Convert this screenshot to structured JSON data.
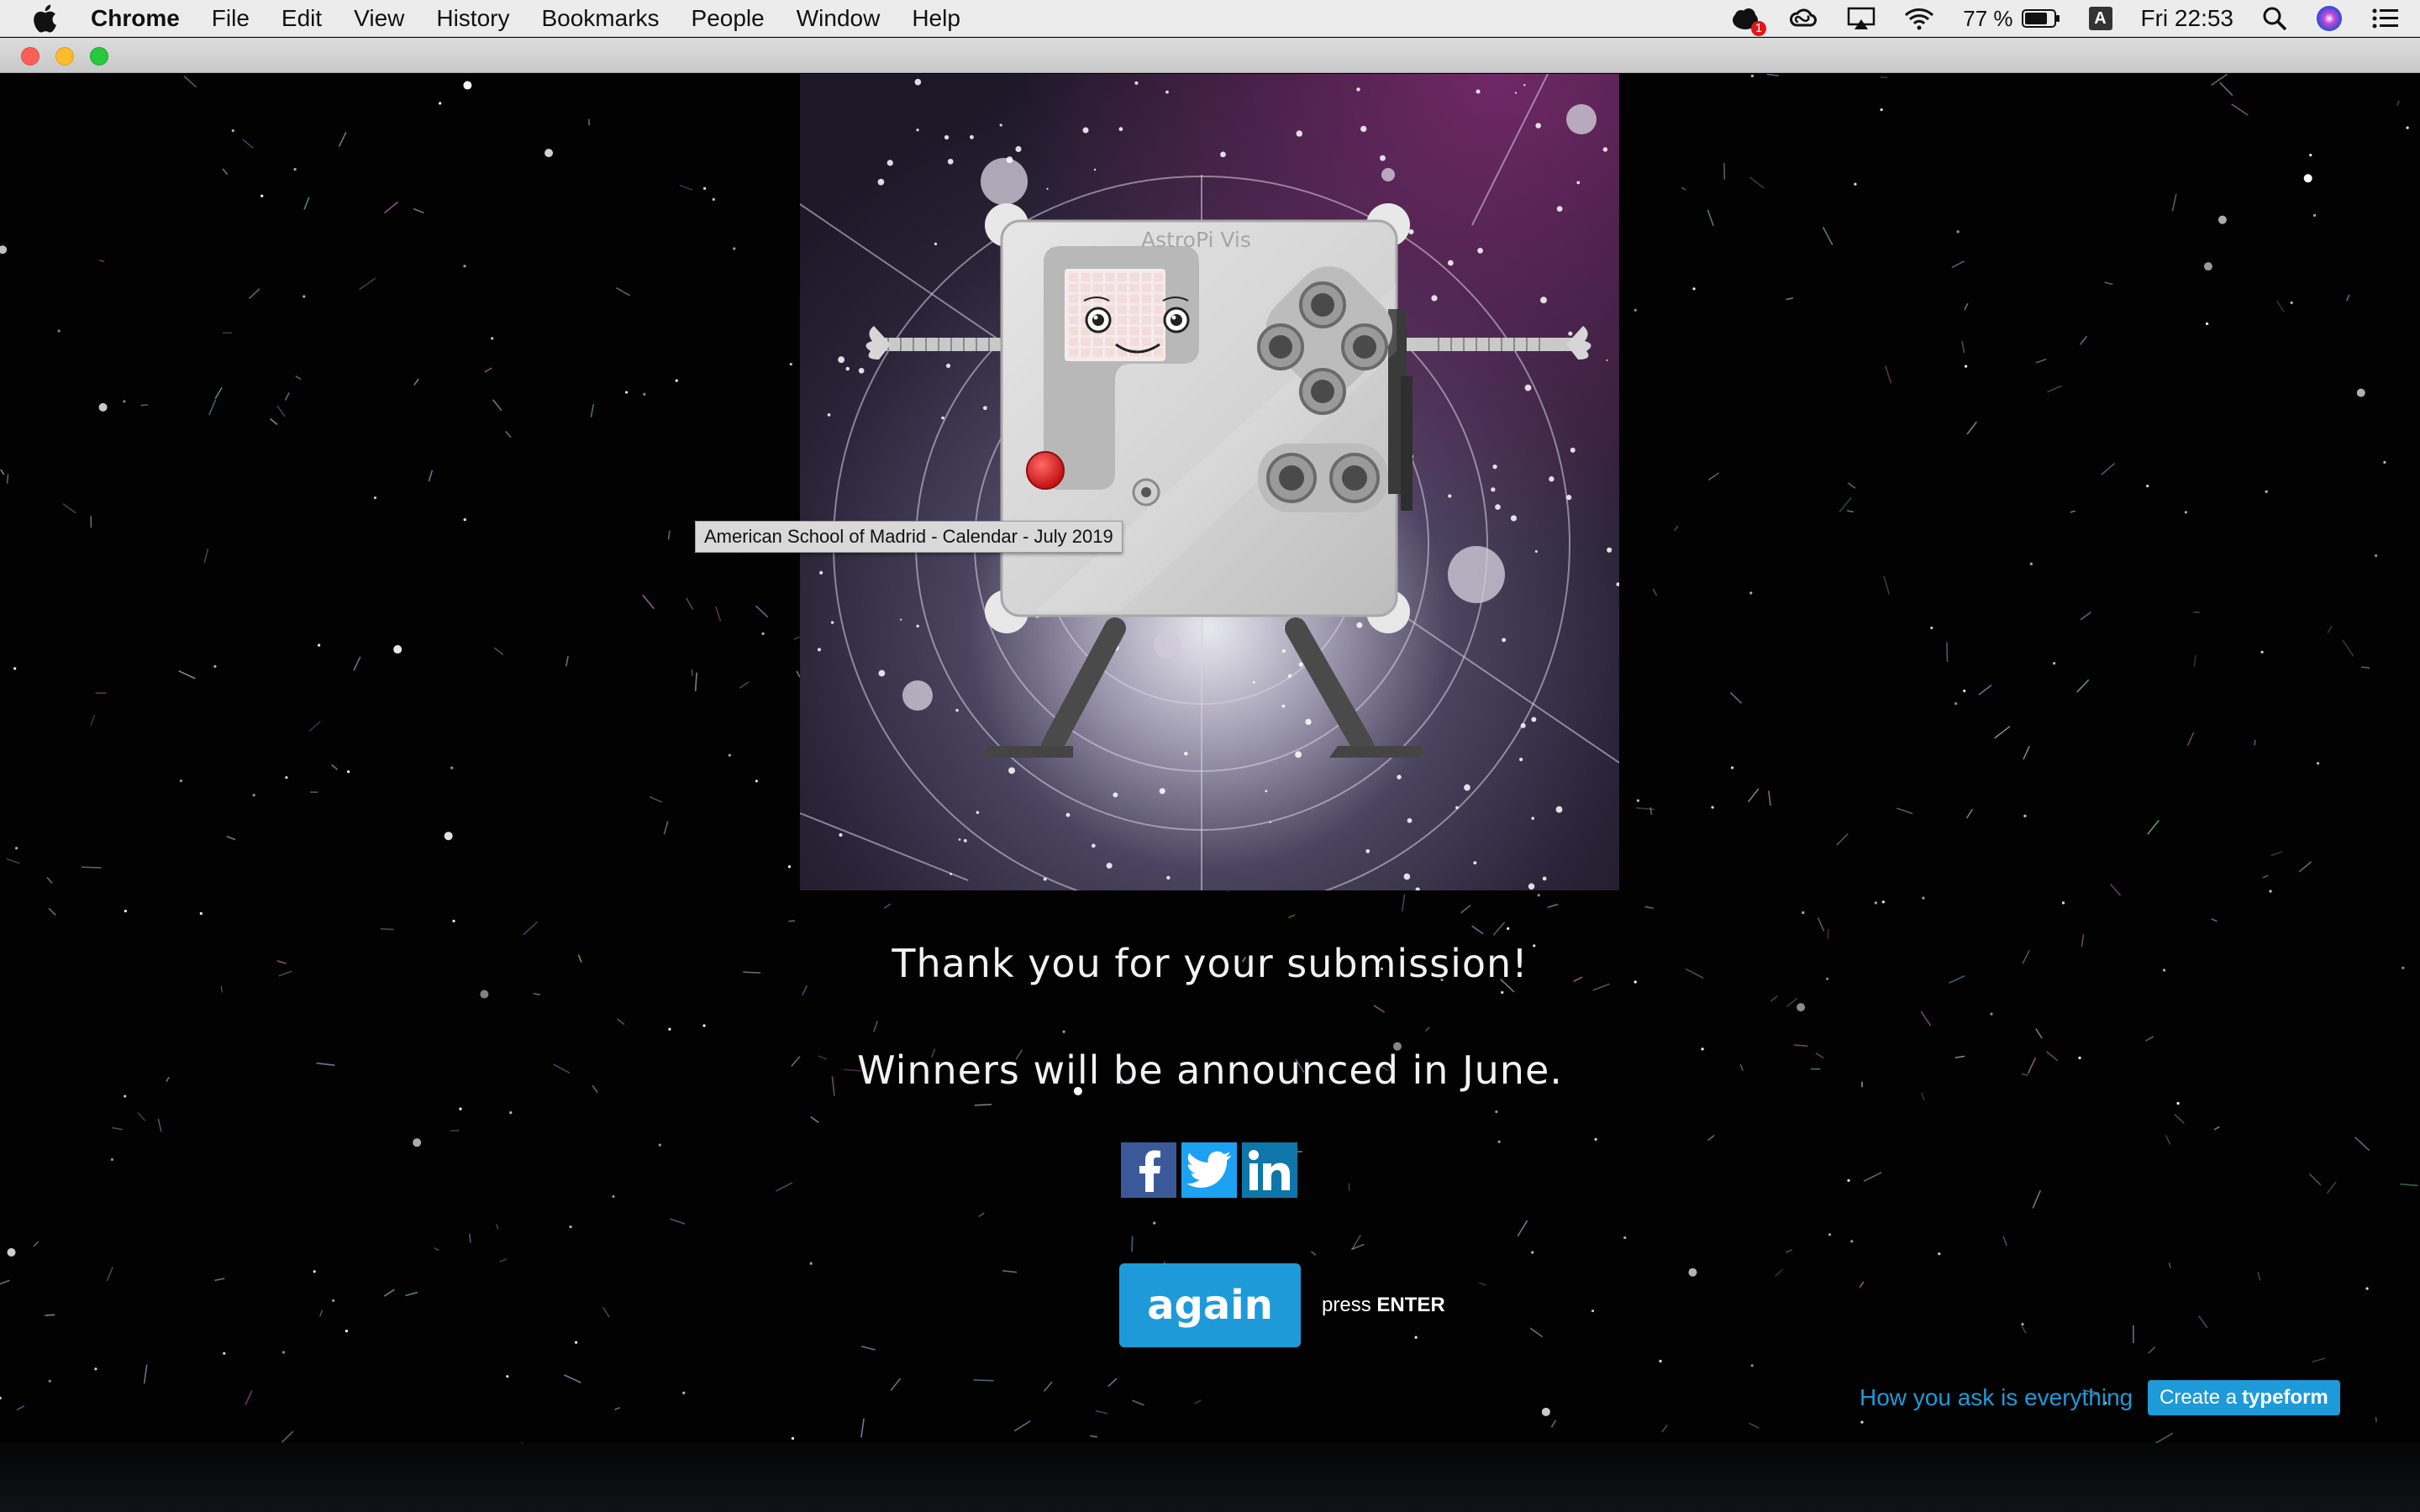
{
  "menubar": {
    "app_name": "Chrome",
    "menus": [
      "File",
      "Edit",
      "View",
      "History",
      "Bookmarks",
      "People",
      "Window",
      "Help"
    ],
    "notification_count": "1",
    "battery": "77 %",
    "input_source": "A",
    "clock": "Fri 22:53"
  },
  "hero": {
    "device_label": "AstroPi Vis"
  },
  "tooltip": {
    "text": "American School of Madrid - Calendar - July 2019"
  },
  "messages": {
    "thanks": "Thank you for your submission!",
    "winners": "Winners will be announced in June."
  },
  "share": {
    "facebook_icon": "facebook-icon",
    "twitter_icon": "twitter-icon",
    "linkedin_icon": "linkedin-icon"
  },
  "actions": {
    "again_label": "again",
    "press_prefix": "press",
    "press_key": "ENTER"
  },
  "footer": {
    "tagline": "How you ask is everything",
    "create_prefix": "Create a",
    "create_brand": "typeform"
  },
  "colors": {
    "accent": "#1e9ad8",
    "facebook": "#3b5998",
    "twitter": "#1da1f2",
    "linkedin": "#0e76a8",
    "record_button": "#d01c1c"
  }
}
